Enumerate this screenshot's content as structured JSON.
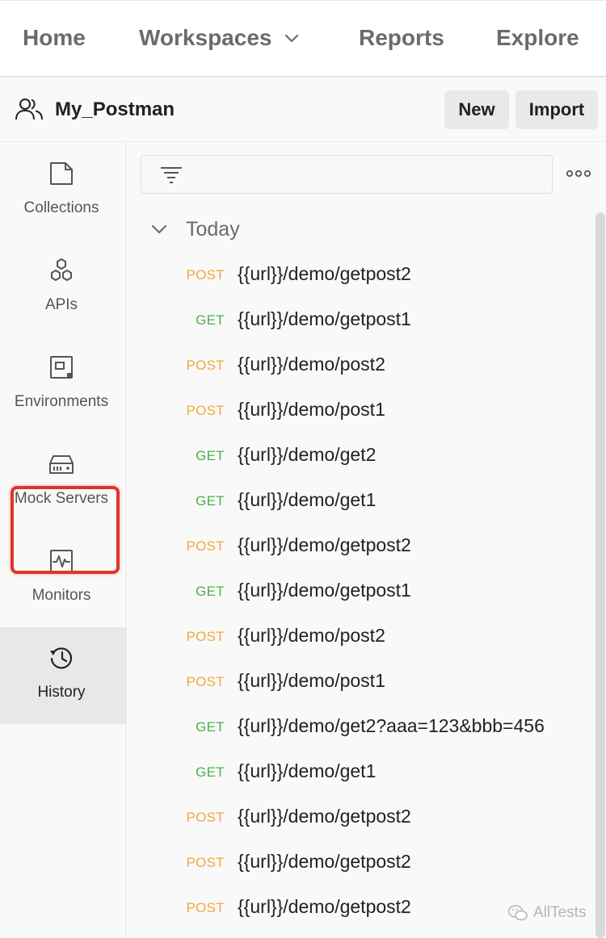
{
  "topnav": {
    "items": [
      "Home",
      "Workspaces",
      "Reports",
      "Explore"
    ]
  },
  "workspace": {
    "name": "My_Postman",
    "new_label": "New",
    "import_label": "Import"
  },
  "sidebar": {
    "items": [
      {
        "label": "Collections",
        "icon": "collections-icon"
      },
      {
        "label": "APIs",
        "icon": "apis-icon"
      },
      {
        "label": "Environments",
        "icon": "environments-icon"
      },
      {
        "label": "Mock Servers",
        "icon": "mock-servers-icon"
      },
      {
        "label": "Monitors",
        "icon": "monitors-icon"
      },
      {
        "label": "History",
        "icon": "history-icon",
        "active": true
      }
    ]
  },
  "history": {
    "group_title": "Today",
    "requests": [
      {
        "method": "POST",
        "url": "{{url}}/demo/getpost2"
      },
      {
        "method": "GET",
        "url": "{{url}}/demo/getpost1"
      },
      {
        "method": "POST",
        "url": "{{url}}/demo/post2"
      },
      {
        "method": "POST",
        "url": "{{url}}/demo/post1"
      },
      {
        "method": "GET",
        "url": "{{url}}/demo/get2"
      },
      {
        "method": "GET",
        "url": "{{url}}/demo/get1"
      },
      {
        "method": "POST",
        "url": "{{url}}/demo/getpost2"
      },
      {
        "method": "GET",
        "url": "{{url}}/demo/getpost1"
      },
      {
        "method": "POST",
        "url": "{{url}}/demo/post2"
      },
      {
        "method": "POST",
        "url": "{{url}}/demo/post1"
      },
      {
        "method": "GET",
        "url": "{{url}}/demo/get2?aaa=123&bbb=456"
      },
      {
        "method": "GET",
        "url": "{{url}}/demo/get1"
      },
      {
        "method": "POST",
        "url": "{{url}}/demo/getpost2"
      },
      {
        "method": "POST",
        "url": "{{url}}/demo/getpost2"
      },
      {
        "method": "POST",
        "url": "{{url}}/demo/getpost2"
      }
    ]
  },
  "watermark": {
    "text": "AllTests"
  },
  "colors": {
    "post": "#f0a93c",
    "get": "#47b34a",
    "highlight": "#e0352b"
  }
}
